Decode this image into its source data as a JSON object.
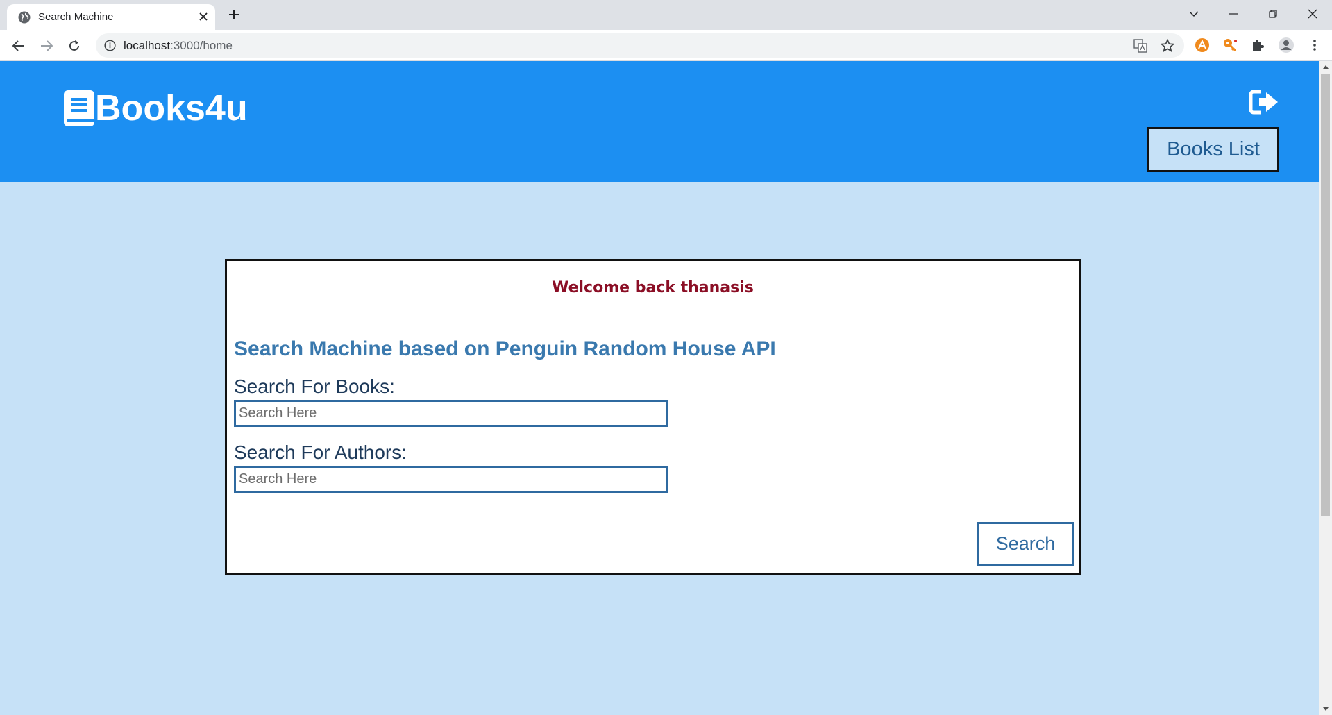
{
  "browser": {
    "tab_title": "Search Machine",
    "url_host": "localhost",
    "url_path": ":3000/home"
  },
  "header": {
    "logo_text": "Books4u",
    "books_list_label": "Books List",
    "color": "#1c8ff2"
  },
  "card": {
    "welcome": "Welcome back thanasis",
    "title": "Search Machine based on Penguin Random House API",
    "books_label": "Search For Books:",
    "books_placeholder": "Search Here",
    "authors_label": "Search For Authors:",
    "authors_placeholder": "Search Here",
    "search_button": "Search"
  },
  "colors": {
    "page_background": "#c6e1f7",
    "accent": "#2f6aa0",
    "welcome": "#8b0e25"
  }
}
